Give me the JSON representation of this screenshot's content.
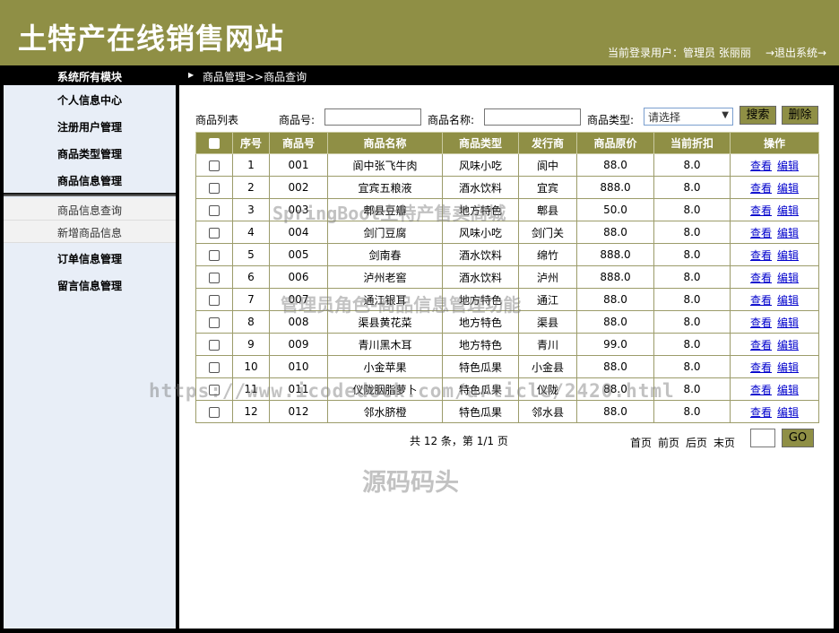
{
  "header": {
    "title": "土特产在线销售网站",
    "current_user": "当前登录用户：管理员 张丽丽",
    "logout": "→退出系统→"
  },
  "topbar": {
    "menu_title": "系统所有模块",
    "breadcrumb": "商品管理>>商品查询"
  },
  "sidebar": {
    "groups": [
      {
        "label": "个人信息中心"
      },
      {
        "label": "注册用户管理"
      },
      {
        "label": "商品类型管理"
      },
      {
        "label": "商品信息管理"
      },
      {
        "label": "订单信息管理"
      },
      {
        "label": "留言信息管理"
      }
    ],
    "sub_items": [
      {
        "label": "商品信息查询"
      },
      {
        "label": "新增商品信息"
      }
    ]
  },
  "search": {
    "list_label": "商品列表",
    "product_no_label": "商品号:",
    "product_name_label": "商品名称:",
    "product_type_label": "商品类型:",
    "type_select_value": "请选择",
    "search_button": "搜索",
    "delete_button": "删除"
  },
  "table": {
    "columns": [
      "序号",
      "商品号",
      "商品名称",
      "商品类型",
      "发行商",
      "商品原价",
      "当前折扣",
      "操作"
    ],
    "view_label": "查看",
    "edit_label": "编辑",
    "rows": [
      [
        "1",
        "001",
        "阆中张飞牛肉",
        "风味小吃",
        "阆中",
        "88.0",
        "8.0"
      ],
      [
        "2",
        "002",
        "宜宾五粮液",
        "酒水饮料",
        "宜宾",
        "888.0",
        "8.0"
      ],
      [
        "3",
        "003",
        "郫县豆瓣",
        "地方特色",
        "郫县",
        "50.0",
        "8.0"
      ],
      [
        "4",
        "004",
        "剑门豆腐",
        "风味小吃",
        "剑门关",
        "88.0",
        "8.0"
      ],
      [
        "5",
        "005",
        "剑南春",
        "酒水饮料",
        "绵竹",
        "888.0",
        "8.0"
      ],
      [
        "6",
        "006",
        "泸州老窖",
        "酒水饮料",
        "泸州",
        "888.0",
        "8.0"
      ],
      [
        "7",
        "007",
        "通江银耳",
        "地方特色",
        "通江",
        "88.0",
        "8.0"
      ],
      [
        "8",
        "008",
        "渠县黄花菜",
        "地方特色",
        "渠县",
        "88.0",
        "8.0"
      ],
      [
        "9",
        "009",
        "青川黑木耳",
        "地方特色",
        "青川",
        "99.0",
        "8.0"
      ],
      [
        "10",
        "010",
        "小金苹果",
        "特色瓜果",
        "小金县",
        "88.0",
        "8.0"
      ],
      [
        "11",
        "011",
        "仪陇胭脂萝卜",
        "特色瓜果",
        "仪陇",
        "88.0",
        "8.0"
      ],
      [
        "12",
        "012",
        "邻水脐橙",
        "特色瓜果",
        "邻水县",
        "88.0",
        "8.0"
      ]
    ]
  },
  "pager": {
    "info": "共 12 条，第 1/1 页",
    "first": "首页",
    "prev": "前页",
    "next": "后页",
    "last": "末页",
    "go": "GO"
  },
  "watermarks": {
    "line1": "SpringBoot土特产售卖商城",
    "line2": "管理员角色-商品信息管理功能",
    "line3": "https://www.icodedock.com/article/2420.html",
    "line4": "源码码头"
  },
  "colors": {
    "olive": "#8f8f45",
    "sidebar_bg": "#e8eef7",
    "link": "#0000cc"
  }
}
